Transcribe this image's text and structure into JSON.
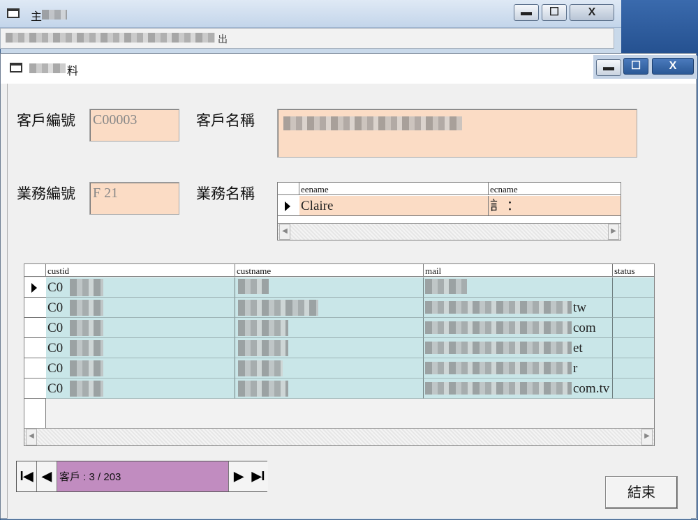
{
  "main_window": {
    "title": "主",
    "menu_text": "",
    "menu_last": "出"
  },
  "child_window": {
    "title": "料"
  },
  "caption_buttons": {
    "minimize": "▬",
    "maximize": "☐",
    "close": "X"
  },
  "form": {
    "customer_id_label": "客戶編號",
    "customer_id_value": "C00003",
    "customer_name_label": "客戶名稱",
    "sales_id_label": "業務編號",
    "sales_id_value": "F  21",
    "sales_name_label": "業務名稱"
  },
  "sales_grid": {
    "columns": [
      "eename",
      "ecname"
    ],
    "rows": [
      {
        "eename": "Claire",
        "ecname": "訁 ："
      }
    ]
  },
  "customer_grid": {
    "columns": [
      "custid",
      "custname",
      "mail",
      "status"
    ],
    "rows": [
      {
        "custid": "C0",
        "custname": "",
        "mail": "",
        "status": ""
      },
      {
        "custid": "C0",
        "custname": "",
        "mail": "tw",
        "status": ""
      },
      {
        "custid": "C0",
        "custname": "",
        "mail": "com",
        "status": ""
      },
      {
        "custid": "C0",
        "custname": "",
        "mail": "et",
        "status": ""
      },
      {
        "custid": "C0",
        "custname": "",
        "mail": "r",
        "status": ""
      },
      {
        "custid": "C0",
        "custname": "",
        "mail": "com.tv",
        "status": ""
      }
    ]
  },
  "navigator": {
    "first": "I◀",
    "prev": "◀",
    "next": "▶",
    "last": "▶I",
    "caption": "客戶 : 3 / 203"
  },
  "end_button_label": "結束",
  "colors": {
    "field_bg": "#fbdcc5",
    "grid_row_bg": "#c9e6e8",
    "nav_caption_bg": "#c18cc0"
  }
}
